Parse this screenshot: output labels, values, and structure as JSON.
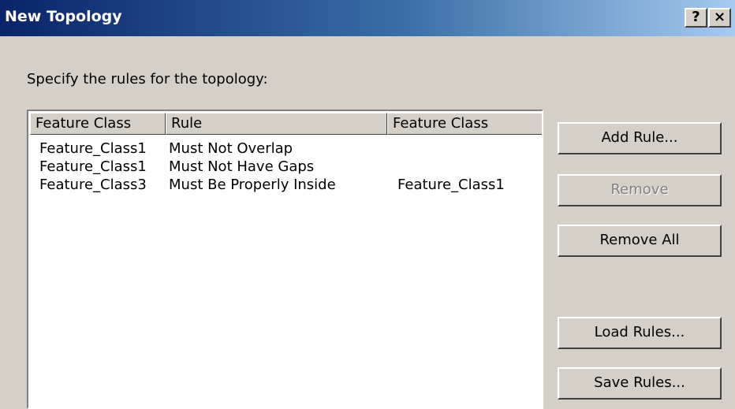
{
  "window": {
    "title": "New Topology",
    "help_label": "?",
    "close_label": "×"
  },
  "prompt": "Specify the rules for the topology:",
  "list": {
    "columns": [
      "Feature Class",
      "Rule",
      "Feature Class"
    ],
    "rows": [
      [
        "Feature_Class1",
        "Must Not Overlap",
        ""
      ],
      [
        "Feature_Class1",
        "Must Not Have Gaps",
        ""
      ],
      [
        "Feature_Class3",
        "Must Be Properly Inside",
        "Feature_Class1"
      ]
    ]
  },
  "buttons": {
    "add_rule": "Add Rule...",
    "remove": "Remove",
    "remove_all": "Remove All",
    "load_rules": "Load Rules...",
    "save_rules": "Save Rules..."
  }
}
